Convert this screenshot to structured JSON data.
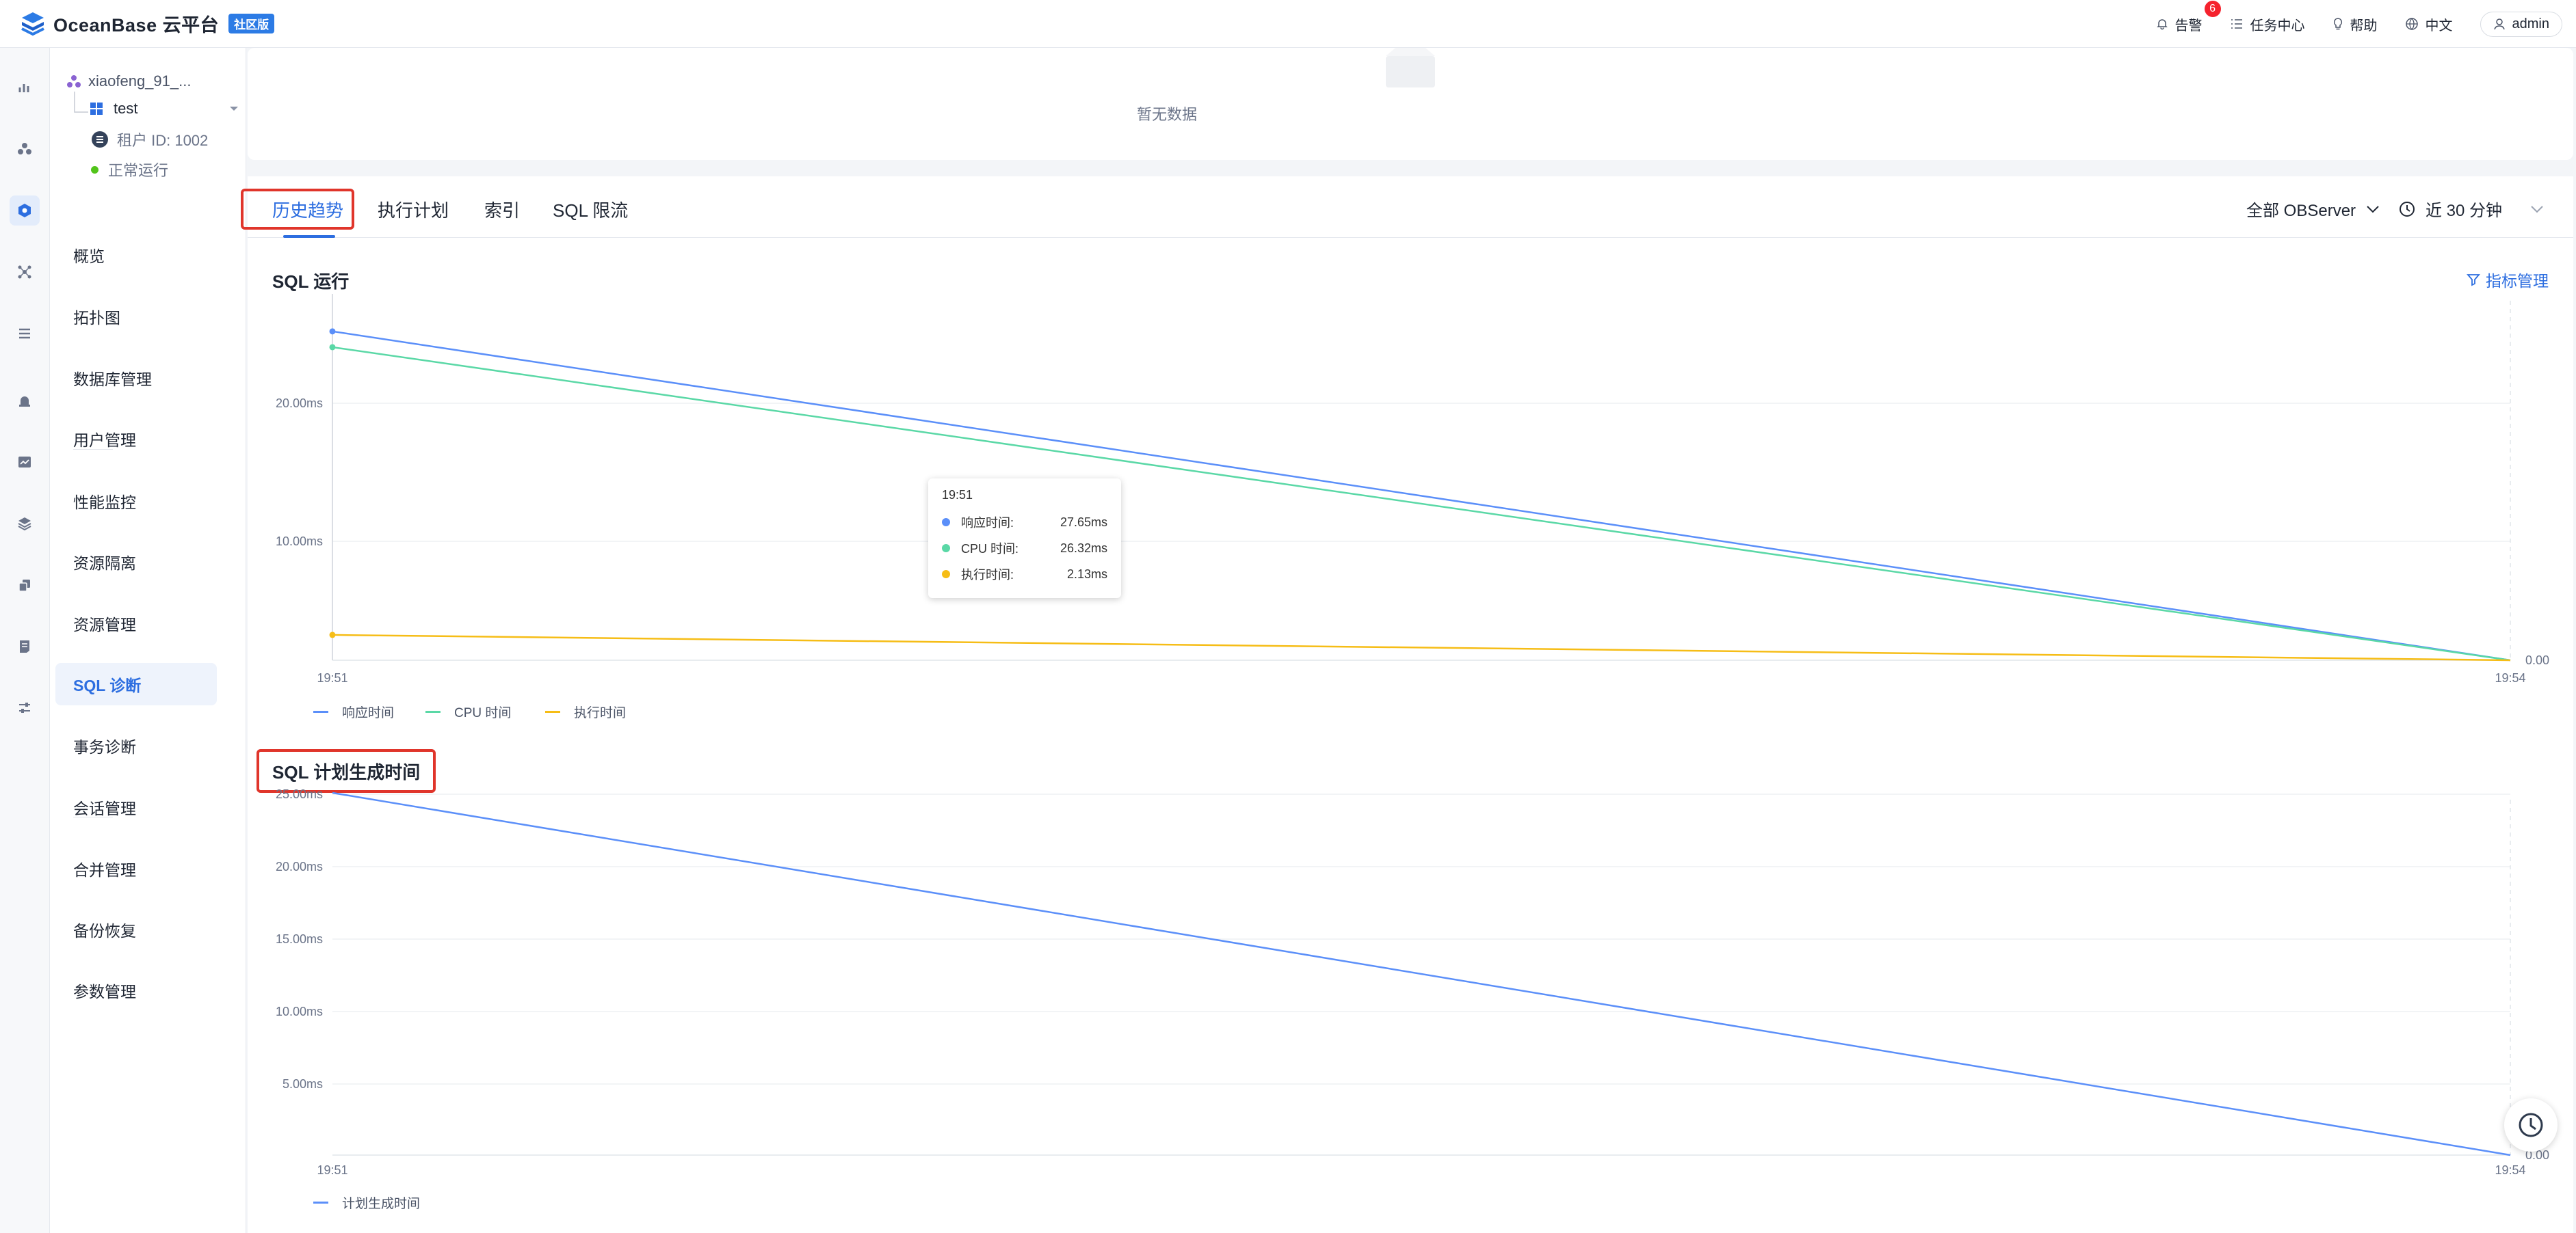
{
  "app": {
    "brand": "OceanBase 云平台",
    "edition": "社区版"
  },
  "topnav": {
    "alerts_label": "告警",
    "alerts_count": "6",
    "tasks_label": "任务中心",
    "help_label": "帮助",
    "lang_label": "中文",
    "user_label": "admin"
  },
  "tenant": {
    "cluster": "xiaofeng_91_...",
    "name": "test",
    "id": "租户 ID: 1002",
    "status": "正常运行"
  },
  "menu": [
    "概览",
    "拓扑图",
    "数据库管理",
    "用户管理",
    "性能监控",
    "资源隔离",
    "资源管理",
    "SQL 诊断",
    "事务诊断",
    "会话管理",
    "合并管理",
    "备份恢复",
    "参数管理"
  ],
  "empty": {
    "text": "暂无数据"
  },
  "tabs": [
    "历史趋势",
    "执行计划",
    "索引",
    "SQL 限流"
  ],
  "controls": {
    "server_select": "全部 OBServer",
    "time_range": "近 30 分钟"
  },
  "metric_link": "指标管理",
  "colors": {
    "blue": "#5b8ff9",
    "green": "#5ad8a6",
    "orange": "#f6bd16",
    "accent": "#2d6ee0",
    "highlight": "#e0352b"
  },
  "chart_data": [
    {
      "type": "line",
      "title": "SQL 运行",
      "x": [
        "19:51",
        "19:54"
      ],
      "series": [
        {
          "name": "响应时间",
          "values": [
            27.65,
            0
          ]
        },
        {
          "name": "CPU 时间",
          "values": [
            26.32,
            0
          ]
        },
        {
          "name": "执行时间",
          "values": [
            2.13,
            0
          ]
        }
      ],
      "yticks": [
        "10.00ms",
        "20.00ms"
      ],
      "right_label": "0.00",
      "tooltip": {
        "time": "19:51",
        "rows": [
          {
            "name": "响应时间:",
            "value": "27.65ms"
          },
          {
            "name": "CPU 时间:",
            "value": "26.32ms"
          },
          {
            "name": "执行时间:",
            "value": "2.13ms"
          }
        ]
      }
    },
    {
      "type": "line",
      "title": "SQL 计划生成时间",
      "x": [
        "19:51",
        "19:54"
      ],
      "series": [
        {
          "name": "计划生成时间",
          "values": [
            25.0,
            0
          ]
        }
      ],
      "yticks": [
        "5.00ms",
        "10.00ms",
        "15.00ms",
        "20.00ms",
        "25.00ms"
      ],
      "right_label": "0.00"
    }
  ]
}
